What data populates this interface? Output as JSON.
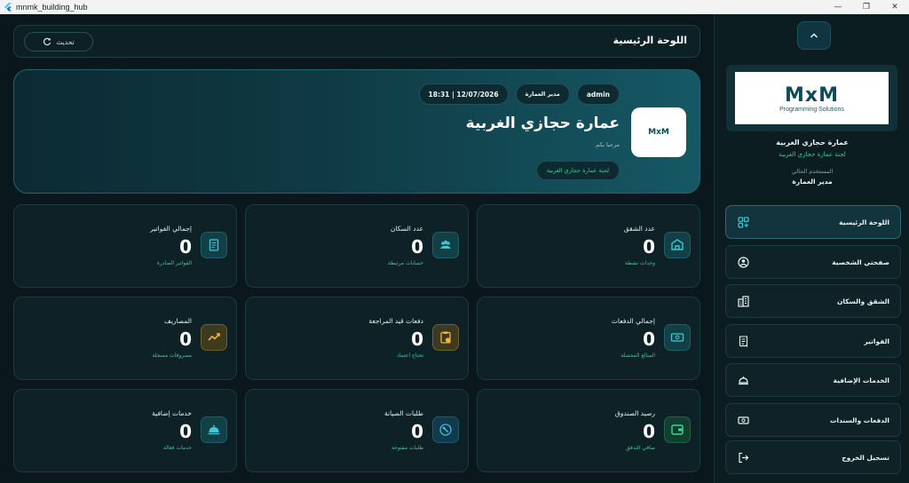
{
  "window": {
    "title": "mnmk_building_hub",
    "controls": [
      "—",
      "❐",
      "✕"
    ]
  },
  "topbar": {
    "title": "اللوحة الرئيسية",
    "refresh_label": "تحديث"
  },
  "hero": {
    "user_chip": "admin",
    "role_chip": "مدير العمارة",
    "datetime_chip": "12/07/2026 | 18:31",
    "building_name": "عمارة حجازي الغربية",
    "welcome": "مرحبا بكم",
    "committee_pill": "لجنة عمارة حجازي الغربية",
    "logo_text": "MxM"
  },
  "sidebar": {
    "logo_mark": "MxM",
    "logo_sub": "Programming Solutions",
    "building_name": "عمارة حجازي الغربية",
    "committee": "لجنة عمارة حجازي الغربية",
    "current_user_label": "المستخدم الحالي",
    "current_user_role": "مدير العمارة",
    "items": [
      {
        "label": "اللوحة الرئيسية",
        "icon": "dashboard-icon"
      },
      {
        "label": "صفحتي الشخصية",
        "icon": "user-circle-icon"
      },
      {
        "label": "الشقق والسكان",
        "icon": "building-icon"
      },
      {
        "label": "الفواتير",
        "icon": "receipt-icon"
      },
      {
        "label": "الخدمات الإضافية",
        "icon": "service-bell-icon"
      },
      {
        "label": "الدفعات والسندات",
        "icon": "payments-icon"
      },
      {
        "label": "تسجيل الخروج",
        "icon": "logout-icon"
      }
    ]
  },
  "stats": [
    {
      "title": "عدد الشقق",
      "value": "0",
      "sub": "وحدات نشطة",
      "icon": "apartment-icon",
      "tone": "teal",
      "color": "#3cc8d6"
    },
    {
      "title": "عدد السكان",
      "value": "0",
      "sub": "حسابات مرتبطة",
      "icon": "people-icon",
      "tone": "teal",
      "color": "#3cc8d6"
    },
    {
      "title": "إجمالي الفواتير",
      "value": "0",
      "sub": "الفواتير الصادرة",
      "icon": "invoice-icon",
      "tone": "teal",
      "color": "#3cc8d6"
    },
    {
      "title": "إجمالي الدفعات",
      "value": "0",
      "sub": "المبالغ المحصلة",
      "icon": "cash-icon",
      "tone": "teal",
      "color": "#3cc8d6"
    },
    {
      "title": "دفعات قيد المراجعة",
      "value": "0",
      "sub": "تحتاج اعتماد",
      "icon": "pending-clipboard-icon",
      "tone": "gold",
      "color": "#f2b53a"
    },
    {
      "title": "المصاريف",
      "value": "0",
      "sub": "مصروفات مسجلة",
      "icon": "trend-icon",
      "tone": "gold",
      "color": "#f2b53a"
    },
    {
      "title": "رصيد الصندوق",
      "value": "0",
      "sub": "صافي التدفق",
      "icon": "wallet-icon",
      "tone": "green",
      "color": "#3ad69b"
    },
    {
      "title": "طلبات الصيانة",
      "value": "0",
      "sub": "طلبات مفتوحة",
      "icon": "wrench-icon",
      "tone": "blue",
      "color": "#48b6e0"
    },
    {
      "title": "خدمات إضافية",
      "value": "0",
      "sub": "خدمات فعالة",
      "icon": "service-bell-icon",
      "tone": "teal",
      "color": "#3cc8d6"
    }
  ]
}
